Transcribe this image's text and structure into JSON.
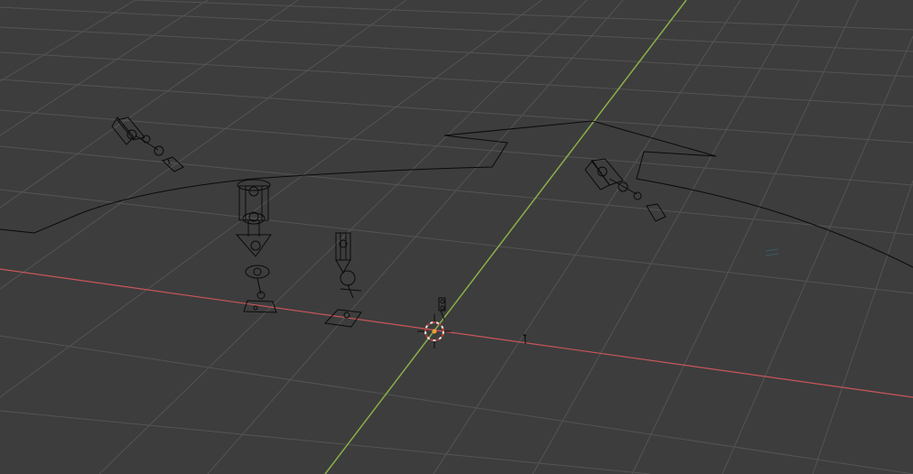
{
  "viewport": {
    "background": "#3d3d3d",
    "grid_color": "#545454",
    "x_axis_color": "#c9565a",
    "y_axis_color": "#8ab04a",
    "wire_color": "#0a0a0a",
    "cursor_colors": [
      "#e0e0e0",
      "#c0392b"
    ],
    "origin_color": "#f0a030"
  },
  "scene": {
    "objects": [
      "armature-rig-top-left",
      "armature-rig-tall",
      "armature-rig-small",
      "armature-rig-tiny",
      "armature-rig-right",
      "curve-path",
      "empty-marker"
    ]
  }
}
